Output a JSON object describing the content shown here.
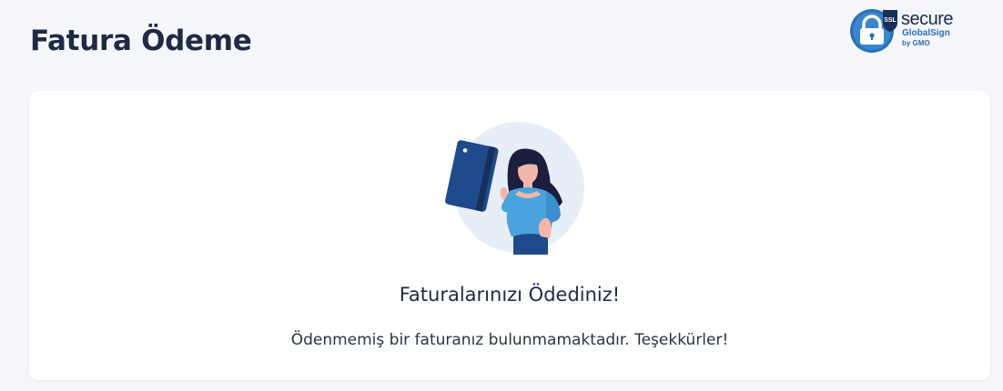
{
  "header": {
    "title": "Fatura Ödeme"
  },
  "ssl_badge": {
    "icon": "lock-shield-icon",
    "tag": "SSL",
    "secure_label": "secure",
    "provider_label": "GlobalSign",
    "by_label": "by GMO"
  },
  "status_card": {
    "illustration": "woman-holding-card-illustration",
    "heading": "Faturalarınızı Ödediniz!",
    "message": "Ödenmemiş bir faturanız bulunmamaktadır. Teşekkürler!"
  },
  "colors": {
    "background": "#f4f6fa",
    "card": "#ffffff",
    "text": "#1f2a44",
    "accent": "#1e4a8c",
    "badge_blue": "#2a70b8"
  }
}
